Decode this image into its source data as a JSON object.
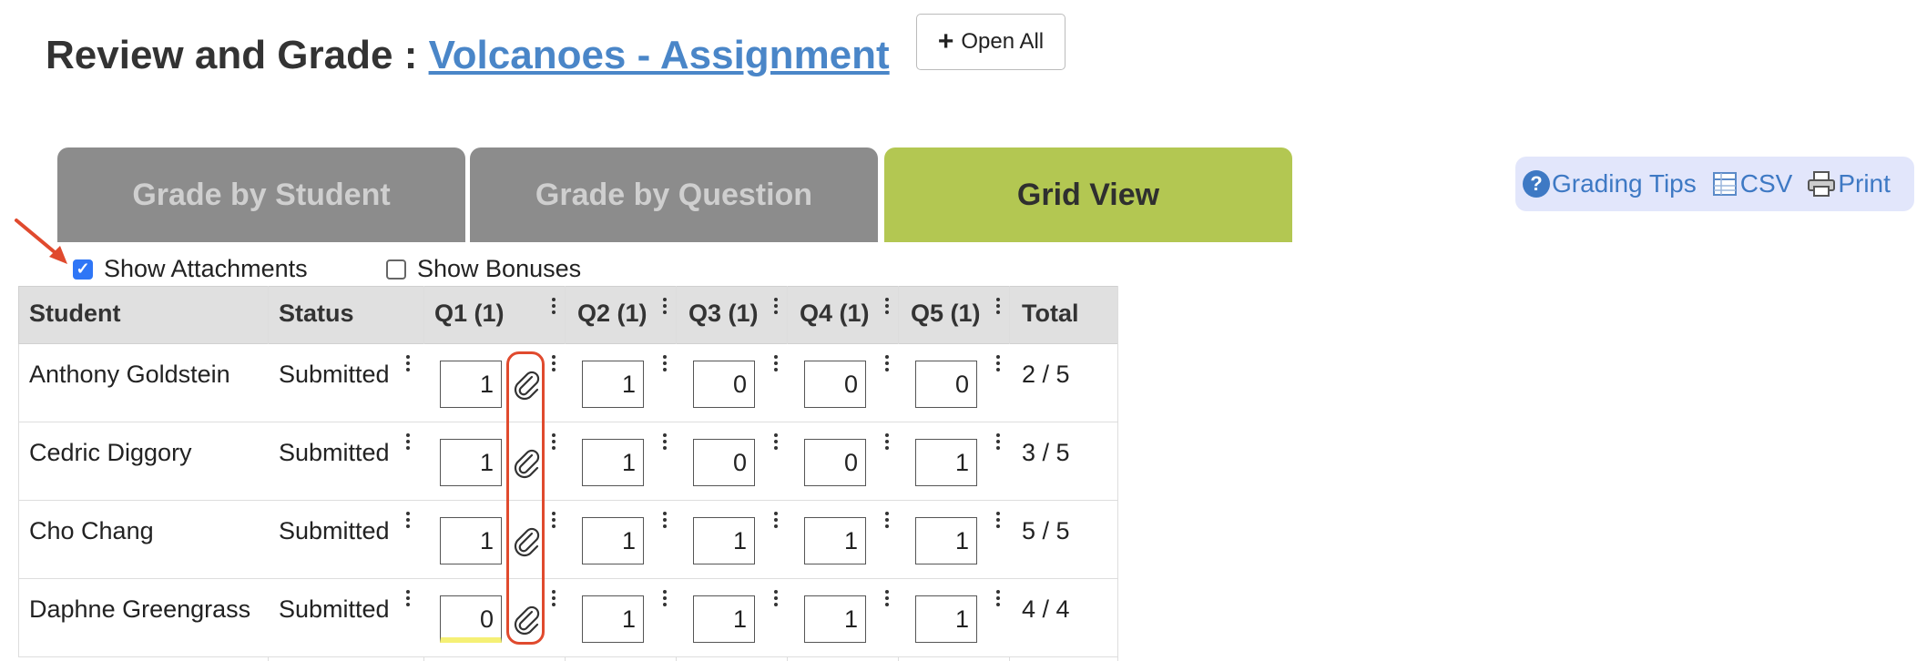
{
  "header": {
    "title_prefix": "Review and Grade : ",
    "assignment_link": "Volcanoes - Assignment",
    "open_all_label": "Open All"
  },
  "tabs": [
    {
      "label": "Grade by Student",
      "active": false
    },
    {
      "label": "Grade by Question",
      "active": false
    },
    {
      "label": "Grid View",
      "active": true
    }
  ],
  "tools": {
    "grading_tips": "Grading Tips",
    "csv": "CSV",
    "print": "Print"
  },
  "options": {
    "show_attachments": {
      "label": "Show Attachments",
      "checked": true
    },
    "show_bonuses": {
      "label": "Show Bonuses",
      "checked": false
    }
  },
  "table": {
    "headers": [
      "Student",
      "Status",
      "Q1 (1)",
      "Q2 (1)",
      "Q3 (1)",
      "Q4 (1)",
      "Q5 (1)",
      "Total"
    ],
    "rows": [
      {
        "student": "Anthony Goldstein",
        "status": "Submitted",
        "scores": [
          "1",
          "1",
          "0",
          "0",
          "0"
        ],
        "total": "2 / 5"
      },
      {
        "student": "Cedric Diggory",
        "status": "Submitted",
        "scores": [
          "1",
          "1",
          "0",
          "0",
          "1"
        ],
        "total": "3 / 5"
      },
      {
        "student": "Cho Chang",
        "status": "Submitted",
        "scores": [
          "1",
          "1",
          "1",
          "1",
          "1"
        ],
        "total": "5 / 5"
      },
      {
        "student": "Daphne Greengrass",
        "status": "Submitted",
        "scores": [
          "0",
          "1",
          "1",
          "1",
          "1"
        ],
        "total": "4 / 4"
      }
    ]
  },
  "colors": {
    "active_tab": "#b3c752",
    "inactive_tab": "#8c8c8c",
    "link": "#4a86c8",
    "highlight_box": "#e04a2e",
    "checkbox": "#2f76f6"
  }
}
